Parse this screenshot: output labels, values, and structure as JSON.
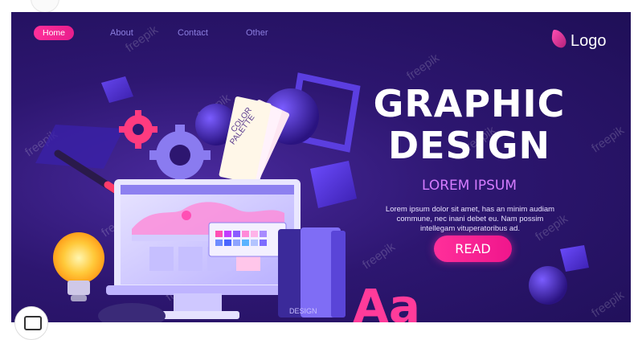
{
  "nav": {
    "items": [
      {
        "label": "Home"
      },
      {
        "label": "About"
      },
      {
        "label": "Contact"
      },
      {
        "label": "Other"
      }
    ]
  },
  "logo": {
    "text": "Logo"
  },
  "hero": {
    "title_line1": "GRAPHIC",
    "title_line2": "DESIGN",
    "subtitle": "LOREM IPSUM",
    "description": "Lorem ipsum dolor sit amet, has an minim audiam commune, nec inani debet eu. Nam possim intellegam vituperatoribus ad.",
    "read_label": "READ"
  },
  "illustration": {
    "palette_label_1": "COLOR",
    "palette_label_2": "PALETTE",
    "book_label": "DESIGN",
    "letters": "Aa"
  },
  "watermark": {
    "text": "freepik"
  },
  "colors": {
    "accent": "#ff2f9a",
    "background": "#2d1670",
    "subtitle": "#d57cff"
  }
}
